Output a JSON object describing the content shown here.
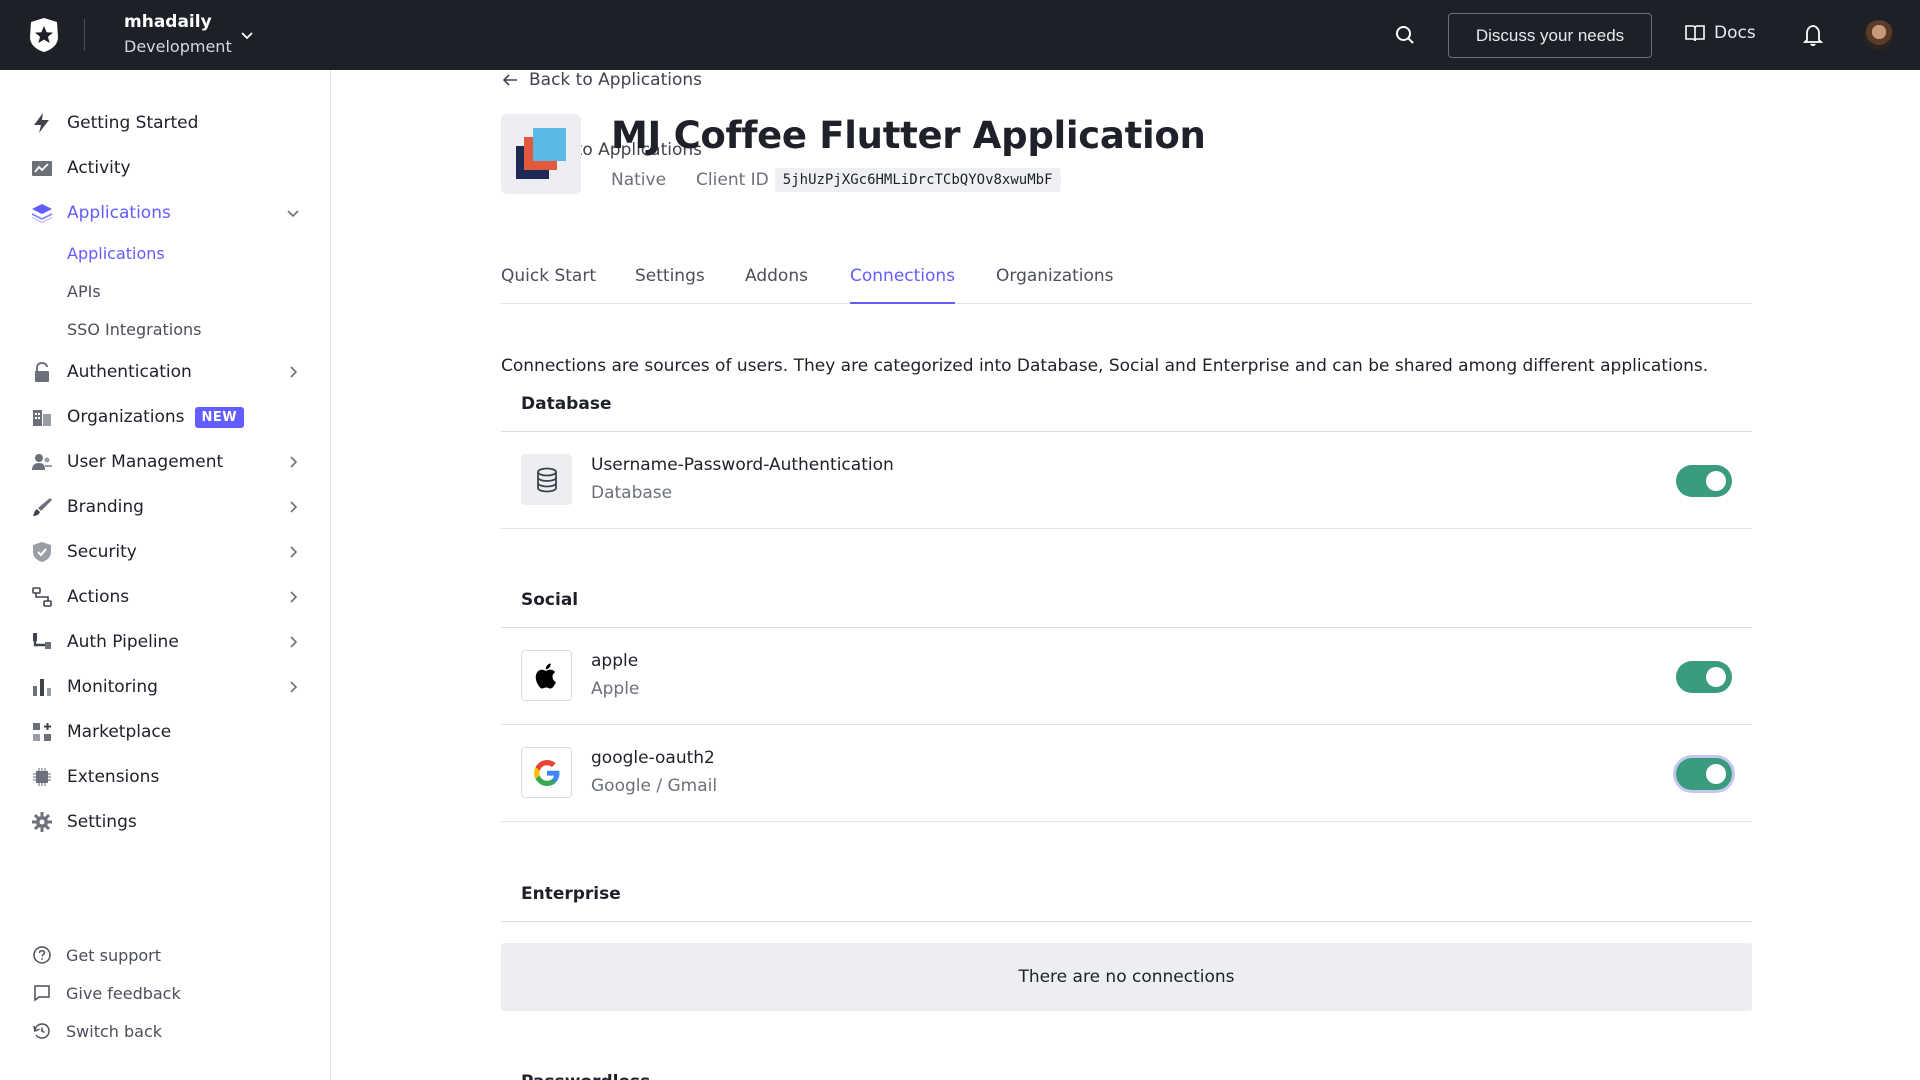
{
  "topbar": {
    "tenant_name": "mhadaily",
    "tenant_env": "Development",
    "discuss_label": "Discuss your needs",
    "docs_label": "Docs"
  },
  "sidebar": {
    "items": [
      {
        "label": "Getting Started",
        "icon": "bolt-icon"
      },
      {
        "label": "Activity",
        "icon": "activity-chart-icon"
      },
      {
        "label": "Applications",
        "icon": "layers-icon"
      },
      {
        "label": "Authentication",
        "icon": "lock-icon"
      },
      {
        "label": "Organizations",
        "icon": "building-icon",
        "badge": "NEW"
      },
      {
        "label": "User Management",
        "icon": "users-icon"
      },
      {
        "label": "Branding",
        "icon": "brush-icon"
      },
      {
        "label": "Security",
        "icon": "shield-icon"
      },
      {
        "label": "Actions",
        "icon": "actions-flow-icon"
      },
      {
        "label": "Auth Pipeline",
        "icon": "pipeline-icon"
      },
      {
        "label": "Monitoring",
        "icon": "bar-chart-icon"
      },
      {
        "label": "Marketplace",
        "icon": "grid-plus-icon"
      },
      {
        "label": "Extensions",
        "icon": "chip-icon"
      },
      {
        "label": "Settings",
        "icon": "gear-icon"
      }
    ],
    "sub_items": [
      "Applications",
      "APIs",
      "SSO Integrations"
    ],
    "footer": [
      "Get support",
      "Give feedback",
      "Switch back"
    ]
  },
  "main": {
    "back_label": "Back to Applications",
    "app_title": "MJ Coffee Flutter Application",
    "app_type": "Native",
    "client_id_label": "Client ID",
    "client_id": "5jhUzPjXGc6HMLiDrcTCbQYOv8xwuMbF",
    "tabs": [
      "Quick Start",
      "Settings",
      "Addons",
      "Connections",
      "Organizations"
    ],
    "active_tab": "Connections",
    "intro": "Connections are sources of users. They are categorized into Database, Social and Enterprise and can be shared among different applications.",
    "sections": {
      "database": {
        "title": "Database",
        "rows": [
          {
            "name": "Username-Password-Authentication",
            "sub": "Database",
            "enabled": true
          }
        ]
      },
      "social": {
        "title": "Social",
        "rows": [
          {
            "name": "apple",
            "sub": "Apple",
            "enabled": true
          },
          {
            "name": "google-oauth2",
            "sub": "Google / Gmail",
            "enabled": true
          }
        ]
      },
      "enterprise": {
        "title": "Enterprise",
        "empty": "There are no connections"
      },
      "passwordless": {
        "title": "Passwordless"
      }
    }
  },
  "colors": {
    "accent": "#635dff",
    "topbar": "#1d2027",
    "toggle_on": "#3a9b7f"
  }
}
